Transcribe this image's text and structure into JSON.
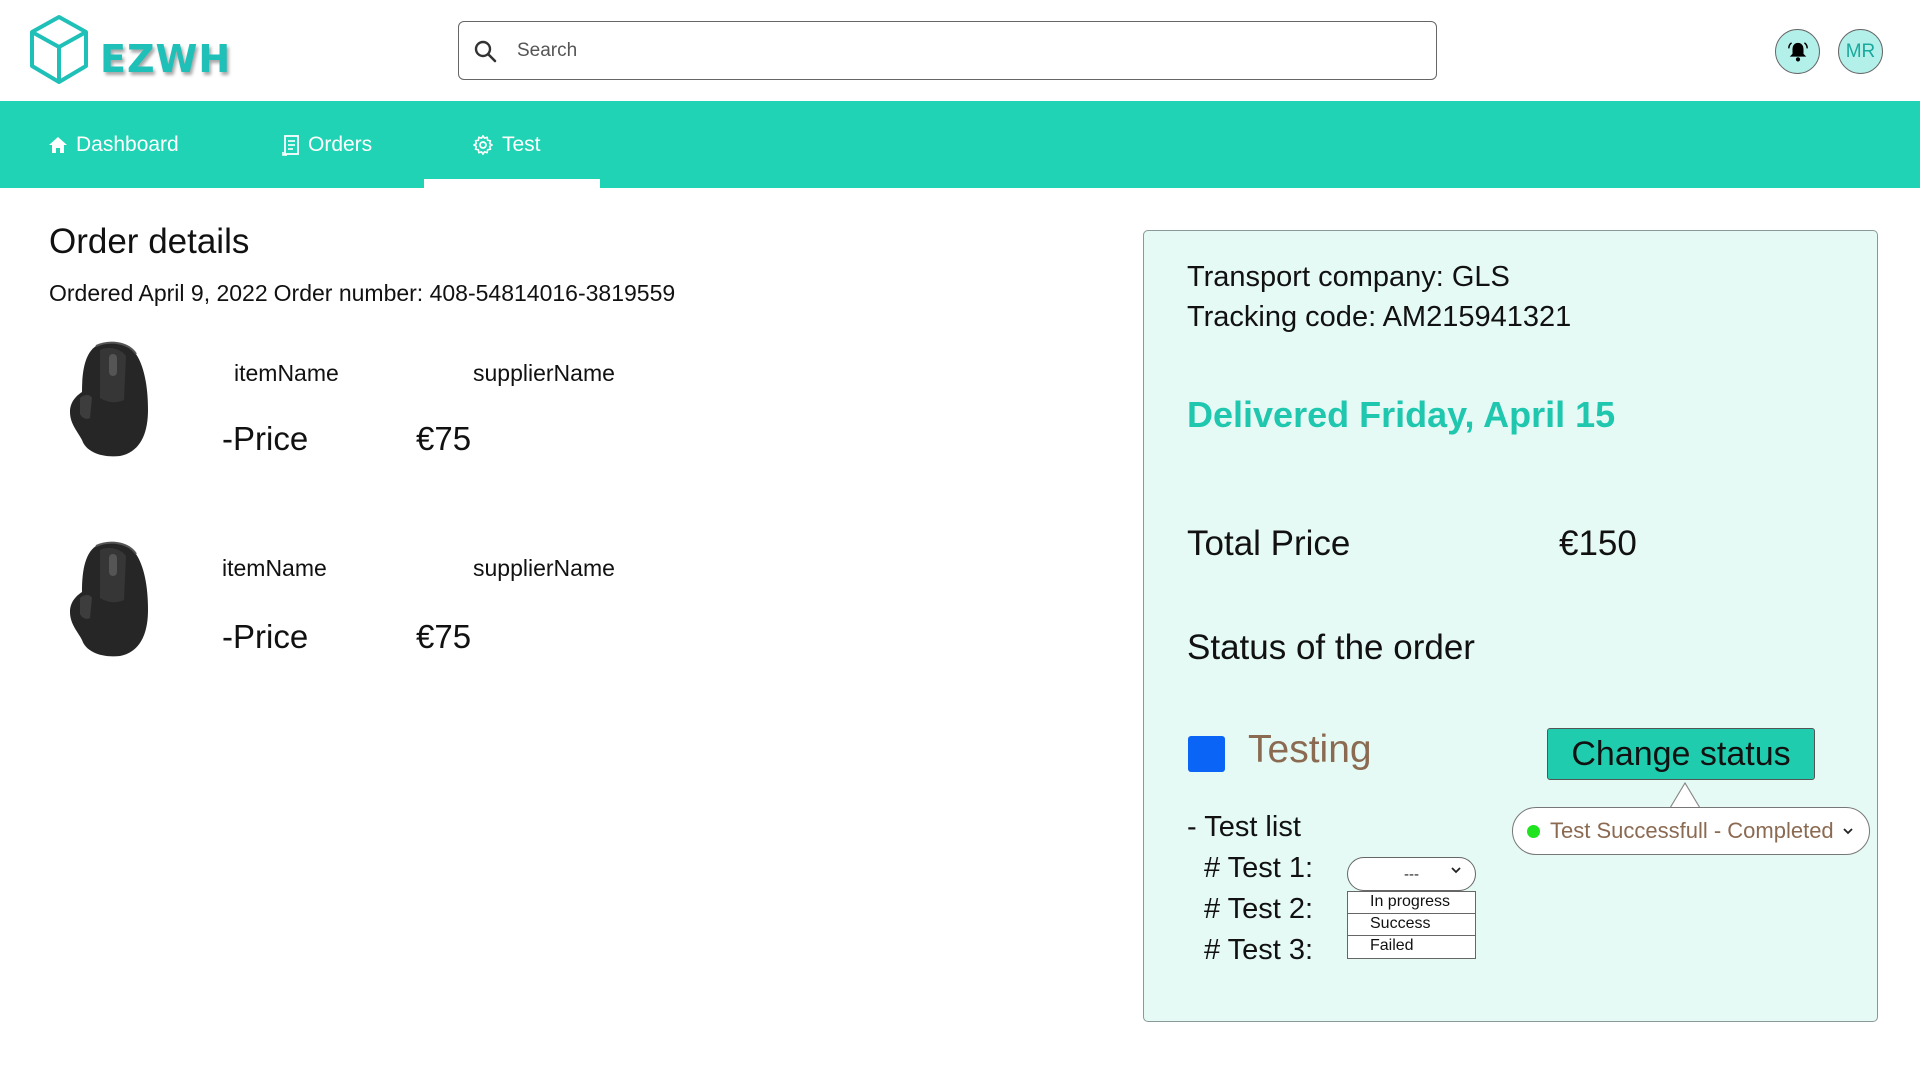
{
  "header": {
    "logo_text": "EZWH",
    "search_placeholder": "Search",
    "notification_icon": "bell-icon",
    "avatar_initials": "MR"
  },
  "nav": {
    "items": [
      {
        "label": "Dashboard",
        "icon": "home-icon"
      },
      {
        "label": "Orders",
        "icon": "receipt-icon"
      },
      {
        "label": "Test",
        "icon": "gear-icon",
        "active": true
      }
    ]
  },
  "order": {
    "title": "Order details",
    "ordered_text": "Ordered April 9, 2022",
    "order_number_text": "Order number: 408-54814016-3819559",
    "items": [
      {
        "name": "itemName",
        "supplier": "supplierName",
        "price_label": "-Price",
        "price": "€75"
      },
      {
        "name": "itemName",
        "supplier": "supplierName",
        "price_label": "-Price",
        "price": "€75"
      }
    ]
  },
  "shipment": {
    "transport": "Transport company: GLS",
    "tracking": "Tracking code: AM215941321",
    "delivered": "Delivered Friday, April 15",
    "total_label": "Total Price",
    "total_value": "€150",
    "status_title": "Status of the order",
    "status_label": "Testing",
    "status_color": "#0a64f5",
    "change_button": "Change status",
    "status_option_selected": "Test Successfull - Completed",
    "test_list_label": "- Test list",
    "tests": [
      "# Test 1:",
      "# Test 2:",
      "# Test 3:"
    ],
    "test_select_value": "---",
    "test_options": [
      "In progress",
      "Success",
      "Failed"
    ]
  },
  "colors": {
    "accent": "#20d3b4",
    "panel_bg": "#e6faf5",
    "delivered": "#1fc7ae"
  }
}
